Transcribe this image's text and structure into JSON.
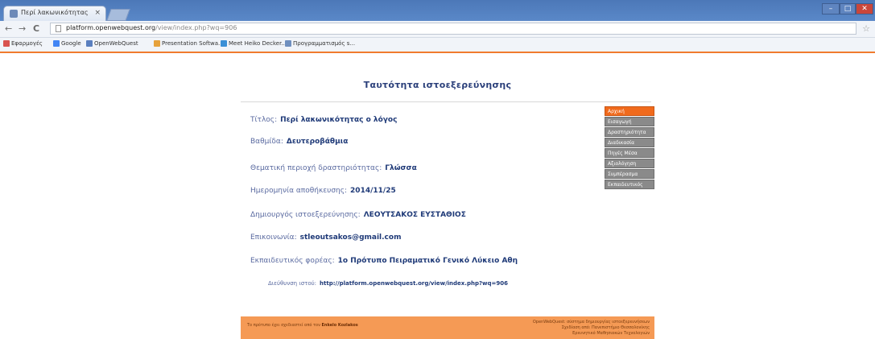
{
  "browser": {
    "tab_title": "Περί λακωνικότητας ο λ",
    "tab_close": "×",
    "url_host": "platform.openwebquest.org",
    "url_path": "/view/index.php?wq=906",
    "nav_back": "←",
    "nav_forward": "→",
    "nav_reload": "C",
    "star": "☆",
    "win_min": "–",
    "win_max": "□",
    "win_close": "✕",
    "bookmarks": [
      {
        "label": "Εφαρμογές",
        "icon_color": "#d9534f"
      },
      {
        "label": "Google",
        "icon_color": "#4285f4"
      },
      {
        "label": "OpenWebQuest",
        "icon_color": "#5a7fbf"
      },
      {
        "label": "Presentation Softwa...",
        "icon_color": "#e6a23c"
      },
      {
        "label": "Meet Heiko Decker...",
        "icon_color": "#3a8fd6"
      },
      {
        "label": "Προγραμματισμός s...",
        "icon_color": "#6f8fbf"
      }
    ]
  },
  "page": {
    "title": "Ταυτότητα ιστοεξερεύνησης",
    "fields": [
      {
        "label": "Τίτλος:",
        "value": "Περί λακωνικότητας ο λόγος"
      },
      {
        "label": "Βαθμίδα:",
        "value": "Δευτεροβάθμια"
      },
      {
        "label": "Θεματική περιοχή δραστηριότητας:",
        "value": "Γλώσσα"
      },
      {
        "label": "Ημερομηνία αποθήκευσης:",
        "value": "2014/11/25"
      },
      {
        "label": "Δημιουργός ιστοεξερεύνησης:",
        "value": "ΛΕΟΥΤΣΑΚΟΣ ΕΥΣΤΑΘΙΟΣ"
      },
      {
        "label": "Επικοινωνία:",
        "value": "stleoutsakos@gmail.com"
      },
      {
        "label": "Εκπαιδευτικός φορέας:",
        "value": "1ο Πρότυπο Πειραματικό Γενικό Λύκειο Αθη"
      }
    ],
    "web_address": {
      "label": "Διεύθυνση ιστού:",
      "value": "http://platform.openwebquest.org/view/index.php?wq=906"
    }
  },
  "side_menu": [
    {
      "label": "Αρχική",
      "active": true
    },
    {
      "label": "Εισαγωγή",
      "active": false
    },
    {
      "label": "Δραστηριότητα",
      "active": false
    },
    {
      "label": "Διαδικασία",
      "active": false
    },
    {
      "label": "Πηγές Μέσα",
      "active": false
    },
    {
      "label": "Αξιολόγηση",
      "active": false
    },
    {
      "label": "Συμπέρασμα",
      "active": false
    },
    {
      "label": "Εκπαιδευτικός",
      "active": false
    }
  ],
  "footer": {
    "left_text": "Το πρότυπο έχει σχεδιαστεί από τον",
    "left_name": "Enkelo Kozlakos",
    "right_lines": [
      "OpenWebQuest: σύστημα δημιουργίας ιστοεξερευνήσεων",
      "Σχεδίαση από: Πανεπιστήμιο Θεσσαλονίκης",
      "Ερευνητικό Μαθησιακών Τεχνολογιών"
    ]
  },
  "colors": {
    "accent_orange": "#f06a1c",
    "footer_bg": "#f59a55",
    "title_blue": "#2a3f7a",
    "menu_gray": "#8a8a8a"
  }
}
